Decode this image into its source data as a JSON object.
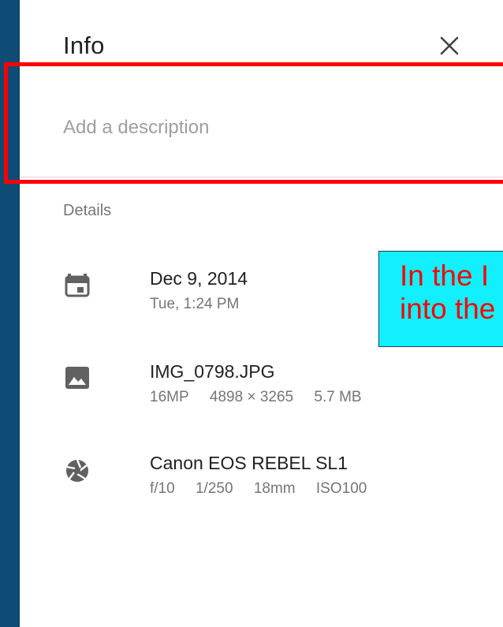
{
  "header": {
    "title": "Info"
  },
  "description": {
    "placeholder": "Add a description"
  },
  "details": {
    "label": "Details",
    "date": {
      "primary": "Dec 9, 2014",
      "secondary": "Tue, 1:24 PM"
    },
    "file": {
      "primary": "IMG_0798.JPG",
      "meta": [
        "16MP",
        "4898 × 3265",
        "5.7 MB"
      ]
    },
    "camera": {
      "primary": "Canon EOS REBEL SL1",
      "meta": [
        "f/10",
        "1/250",
        "18mm",
        "ISO100"
      ]
    }
  },
  "annotation": {
    "line1": "In the I",
    "line2": "into the"
  },
  "icons": {
    "close": "close-icon",
    "date": "calendar-icon",
    "file": "image-icon",
    "camera": "camera-aperture-icon"
  },
  "colors": {
    "highlight": "#ff0000",
    "tooltip_bg": "#12f0ff",
    "tooltip_text": "#ff0000",
    "backdrop": "#0f4c75"
  }
}
